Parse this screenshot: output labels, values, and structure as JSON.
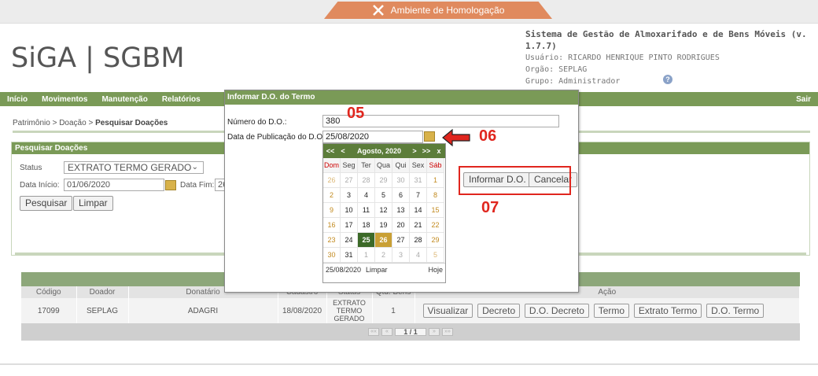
{
  "environment": {
    "label": "Ambiente de Homologação"
  },
  "header": {
    "logo": "SiGA | SGBM",
    "system_name": "Sistema de Gestão de Almoxarifado e de Bens Móveis (v. 1.7.7)",
    "user": "Usuário: RICARDO HENRIQUE PINTO RODRIGUES",
    "org": "Orgão: SEPLAG",
    "group": "Grupo: Administrador",
    "help": "?"
  },
  "menu": {
    "items": [
      "Início",
      "Movimentos",
      "Manutenção",
      "Relatórios"
    ],
    "logout": "Sair"
  },
  "breadcrumb": {
    "path": "Patrimônio > Doação > ",
    "current": "Pesquisar Doações"
  },
  "search": {
    "title": "Pesquisar Doações",
    "status_label": "Status",
    "status_value": "EXTRATO TERMO GERADO",
    "start_label": "Data Início:",
    "start_value": "01/06/2020",
    "end_label": "Data Fim:",
    "end_value": "26",
    "search_button": "Pesquisar",
    "clear_button": "Limpar"
  },
  "table": {
    "headers": [
      "Código",
      "Doador",
      "Donatário",
      "Cadastro",
      "Status",
      "Qtd. Bens",
      "Ação"
    ],
    "rows": [
      {
        "codigo": "17099",
        "doador": "SEPLAG",
        "donatario": "ADAGRI",
        "cadastro": "18/08/2020",
        "status": [
          "EXTRATO",
          "TERMO",
          "GERADO"
        ],
        "qtd": "1"
      }
    ],
    "actions": [
      "Visualizar",
      "Decreto",
      "D.O. Decreto",
      "Termo",
      "Extrato Termo",
      "D.O. Termo"
    ],
    "pager": {
      "first": "««",
      "prev": "«",
      "current": "1 / 1",
      "next": "»",
      "last": "»»"
    }
  },
  "dialog": {
    "title": "Informar D.O. do Termo",
    "numero_label": "Número do D.O.:",
    "numero_value": "380",
    "data_label": "Data de Publicação do D.O.:",
    "data_value": "25/08/2020",
    "submit": "Informar D.O.",
    "cancel": "Cancelar"
  },
  "annotations": {
    "a05": "05",
    "a06": "06",
    "a07": "07",
    "color": "#e0261e"
  },
  "calendar": {
    "nav": {
      "prev_year": "<<",
      "prev_month": "<",
      "month": "Agosto, 2020",
      "next_month": ">",
      "next_year": ">>",
      "close": "x"
    },
    "weekdays": [
      "Dom",
      "Seg",
      "Ter",
      "Qua",
      "Qui",
      "Sex",
      "Sáb"
    ],
    "weeks": [
      [
        "26",
        "27",
        "28",
        "29",
        "30",
        "31",
        "1"
      ],
      [
        "2",
        "3",
        "4",
        "5",
        "6",
        "7",
        "8"
      ],
      [
        "9",
        "10",
        "11",
        "12",
        "13",
        "14",
        "15"
      ],
      [
        "16",
        "17",
        "18",
        "19",
        "20",
        "21",
        "22"
      ],
      [
        "23",
        "24",
        "25",
        "26",
        "27",
        "28",
        "29"
      ],
      [
        "30",
        "31",
        "1",
        "2",
        "3",
        "4",
        "5"
      ]
    ],
    "selected": "25",
    "today": "26",
    "footer_date": "25/08/2020",
    "footer_clear": "Limpar",
    "footer_today": "Hoje"
  },
  "colors": {
    "menu_green": "#7a9a57",
    "accent_orange": "#e08a5e"
  }
}
